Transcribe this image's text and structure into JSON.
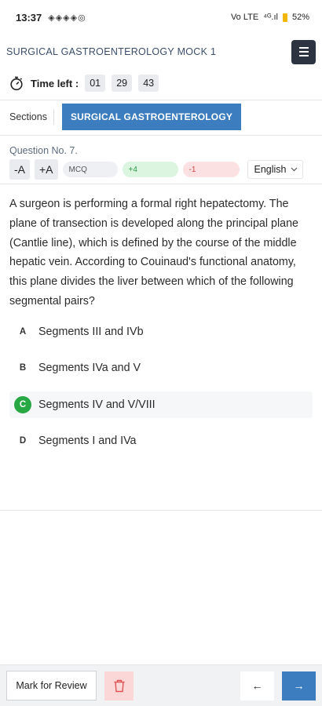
{
  "status_bar": {
    "time": "13:37",
    "left_icons": "◈◈◈◈◎",
    "network": "Vo LTE",
    "signal": "⁴ᴳ.ıl",
    "battery": "52%"
  },
  "app": {
    "title": "SURGICAL GASTROENTEROLOGY MOCK 1",
    "menu_icon": "hamburger-menu-icon"
  },
  "timer": {
    "label": "Time left :",
    "hours": "01",
    "minutes": "29",
    "seconds": "43"
  },
  "sections": {
    "label": "Sections",
    "active_tab": "SURGICAL GASTROENTEROLOGY",
    "accent_color": "#3b7dbf"
  },
  "question": {
    "number_label": "Question No. 7.",
    "font_decrease": "-A",
    "font_increase": "+A",
    "type": "MCQ",
    "positive_marks": "+4",
    "negative_marks": "-1",
    "language": "English",
    "text": "A surgeon is performing a formal right hepatectomy. The plane of transection is developed along the principal plane (Cantlie line), which is defined by the course of the middle hepatic vein. According to Couinaud's functional anatomy, this plane divides the liver between which of the following segmental pairs?",
    "options": [
      {
        "letter": "A",
        "text": "Segments III and IVb",
        "selected": false
      },
      {
        "letter": "B",
        "text": "Segments IVa and V",
        "selected": false
      },
      {
        "letter": "C",
        "text": "Segments IV and V/VIII",
        "selected": true
      },
      {
        "letter": "D",
        "text": "Segments I and IVa",
        "selected": false
      }
    ],
    "selected_color": "#28a745"
  },
  "bottom_bar": {
    "review_label": "Mark for Review",
    "delete_icon": "trash-icon",
    "prev_icon": "arrow-left-icon",
    "prev_glyph": "←",
    "next_icon": "arrow-right-icon",
    "next_glyph": "→"
  }
}
